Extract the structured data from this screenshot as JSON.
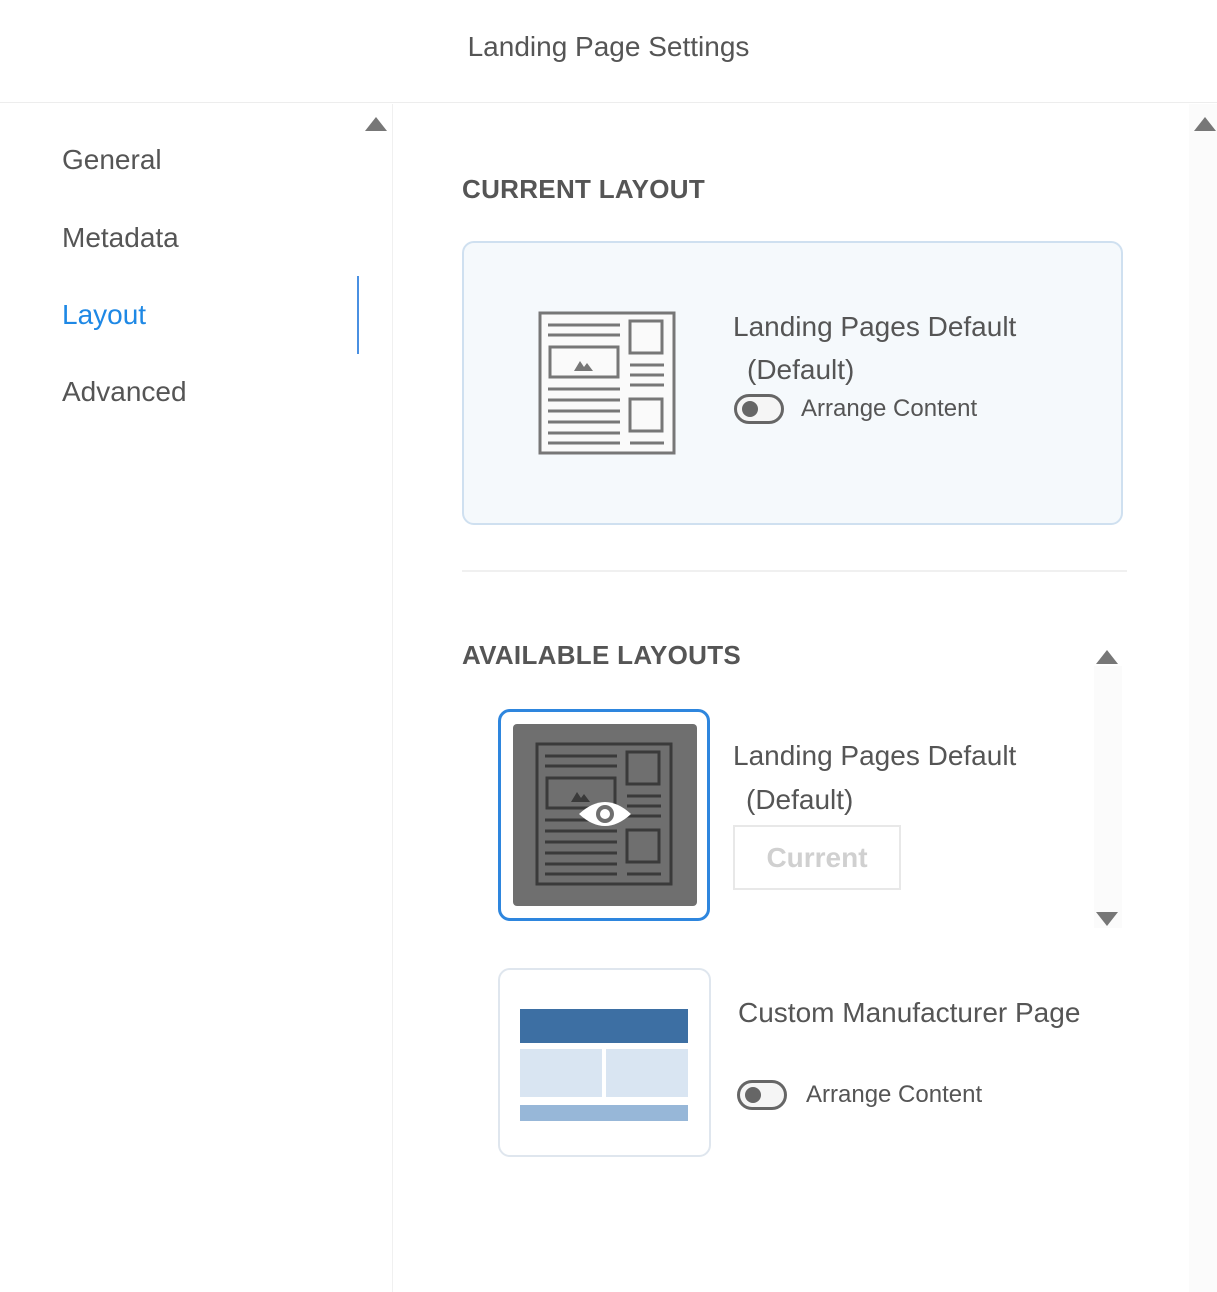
{
  "header": {
    "title": "Landing Page Settings"
  },
  "sidebar": {
    "items": [
      {
        "label": "General"
      },
      {
        "label": "Metadata"
      },
      {
        "label": "Layout"
      },
      {
        "label": "Advanced"
      }
    ],
    "active": "Layout"
  },
  "current_layout": {
    "section_title": "CURRENT LAYOUT",
    "name_line1": "Landing Pages Default",
    "name_line2": "(Default)",
    "toggle_label": "Arrange Content",
    "toggle_on": false
  },
  "available_layouts": {
    "section_title": "AVAILABLE LAYOUTS",
    "items": [
      {
        "name_line1": "Landing Pages Default",
        "name_line2": "(Default)",
        "button_label": "Current",
        "selected": true
      },
      {
        "name": "Custom Manufacturer Page",
        "toggle_label": "Arrange Content",
        "toggle_on": false
      }
    ]
  },
  "colors": {
    "accent": "#1e88e5",
    "text": "#555555",
    "card_border": "#cfe0f0",
    "layout_dark_blue": "#3d6fa3",
    "layout_light_blue": "#d9e5f2",
    "layout_mid_blue": "#97b7d8"
  },
  "icons": {
    "scroll_up": "triangle-up-icon",
    "scroll_down": "triangle-down-icon",
    "preview": "eye-icon",
    "layout": "page-layout-icon"
  }
}
